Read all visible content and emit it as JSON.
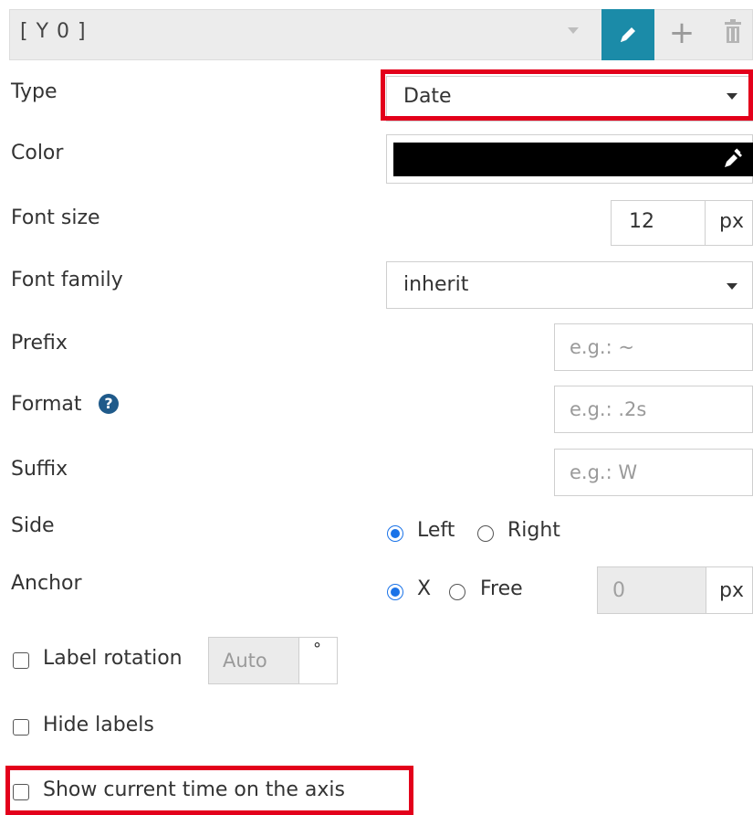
{
  "axis": {
    "name": "[ Y 0 ]",
    "add_label": "+",
    "edit_icon": "pencil-icon",
    "delete_icon": "trash-icon"
  },
  "fields": {
    "type": {
      "label": "Type",
      "value": "Date"
    },
    "color": {
      "label": "Color",
      "value": "#000000",
      "picker_icon": "eyedropper-icon"
    },
    "font_size": {
      "label": "Font size",
      "value": "12",
      "unit": "px"
    },
    "font_family": {
      "label": "Font family",
      "value": "inherit"
    },
    "prefix": {
      "label": "Prefix",
      "placeholder": "e.g.: ~"
    },
    "format": {
      "label": "Format",
      "placeholder": "e.g.: .2s",
      "help_icon": "question-circle-icon"
    },
    "suffix": {
      "label": "Suffix",
      "placeholder": "e.g.: W"
    },
    "side": {
      "label": "Side",
      "options": [
        "Left",
        "Right"
      ],
      "selected": "Left"
    },
    "anchor": {
      "label": "Anchor",
      "options": [
        "X",
        "Free"
      ],
      "selected": "X",
      "value": "0",
      "unit": "px"
    },
    "label_rotation": {
      "label": "Label rotation",
      "placeholder": "Auto",
      "unit": "°",
      "checked": false
    },
    "hide_labels": {
      "label": "Hide labels",
      "checked": false
    },
    "show_current_time": {
      "label": "Show current time on the axis",
      "checked": false
    }
  },
  "colors": {
    "accent": "#1b8ba8",
    "highlight": "#e3001b",
    "radio": "#1a73e8"
  }
}
